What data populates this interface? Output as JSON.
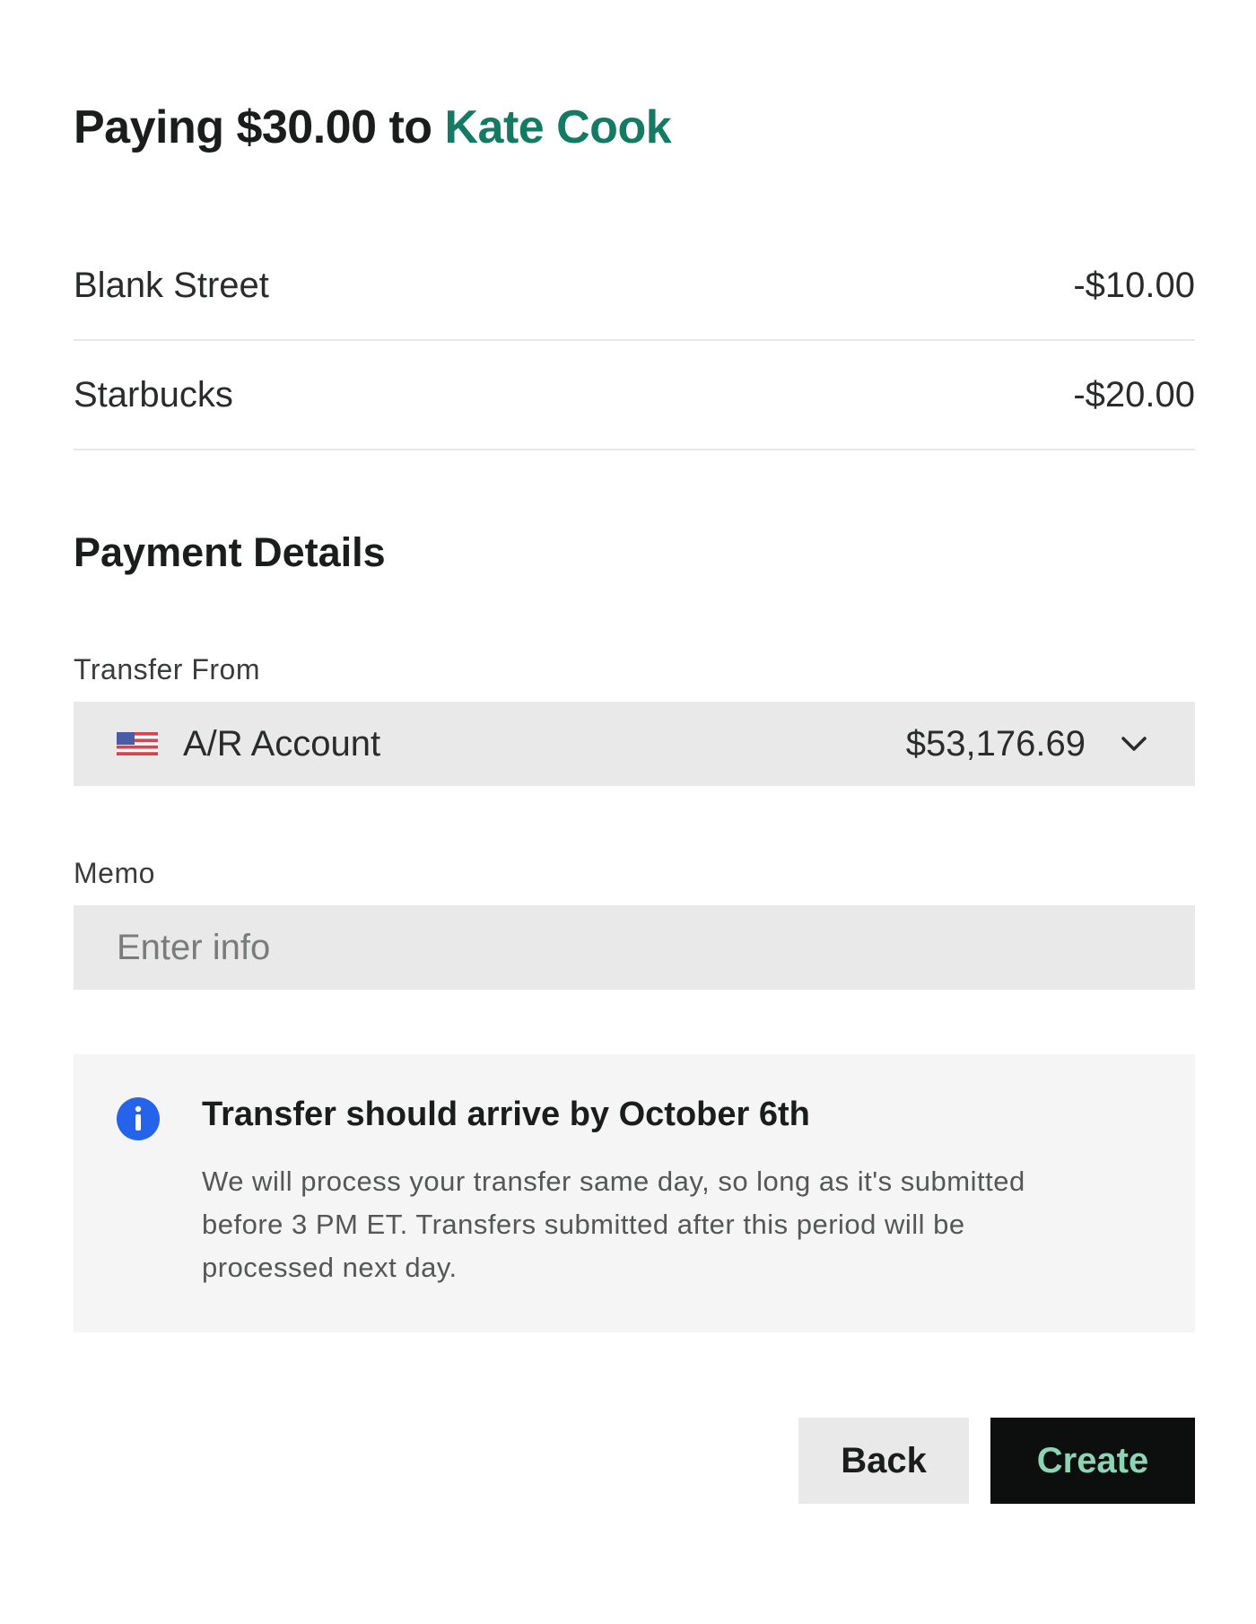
{
  "header": {
    "title_prefix": "Paying $30.00 to ",
    "payee": "Kate Cook"
  },
  "line_items": [
    {
      "name": "Blank Street",
      "amount": "-$10.00"
    },
    {
      "name": "Starbucks",
      "amount": "-$20.00"
    }
  ],
  "payment_details": {
    "section_title": "Payment Details",
    "transfer_from": {
      "label": "Transfer From",
      "account_name": "A/R Account",
      "balance": "$53,176.69",
      "flag_icon": "us-flag-icon"
    },
    "memo": {
      "label": "Memo",
      "placeholder": "Enter info",
      "value": ""
    }
  },
  "notice": {
    "icon": "info-icon",
    "heading": "Transfer should arrive by October 6th",
    "body": "We will process your transfer same day, so long as it's submitted before 3 PM ET. Transfers submitted after this period will be processed next day."
  },
  "actions": {
    "back_label": "Back",
    "create_label": "Create"
  },
  "colors": {
    "accent": "#137a63",
    "info_blue": "#2563eb",
    "create_bg": "#0c0f0e",
    "create_text": "#8fd3b6"
  }
}
